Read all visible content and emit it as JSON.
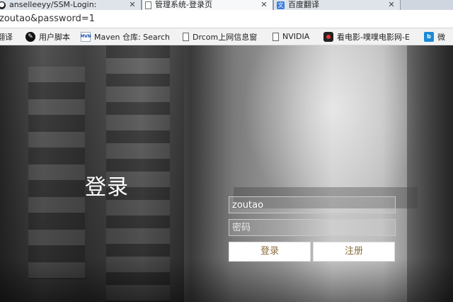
{
  "tabs": [
    {
      "label": "anselleeyy/SSM-Login:",
      "icon": "github-icon",
      "active": false
    },
    {
      "label": "管理系统-登录页",
      "icon": "document-icon",
      "active": true
    },
    {
      "label": "百度翻译",
      "icon": "translate-icon",
      "active": false
    }
  ],
  "address_bar": {
    "url": "zoutao&password=1"
  },
  "bookmarks": [
    {
      "label": "翻译",
      "icon": ""
    },
    {
      "label": "用户脚本",
      "icon": "user-script-icon"
    },
    {
      "label": "Maven 仓库: Search",
      "icon": "maven-icon"
    },
    {
      "label": "Drcom上网信息窗",
      "icon": "document-icon"
    },
    {
      "label": "NVIDIA",
      "icon": "document-icon"
    },
    {
      "label": "看电影-噗噗电影网-E",
      "icon": "movie-icon"
    },
    {
      "label": "微",
      "icon": "bing-icon"
    }
  ],
  "login": {
    "title": "登录",
    "username_value": "zoutao",
    "password_placeholder": "密码",
    "login_button": "登录",
    "register_button": "注册"
  },
  "colors": {
    "button_text": "#8a6d3b",
    "input_border": "#c8c8c8"
  }
}
